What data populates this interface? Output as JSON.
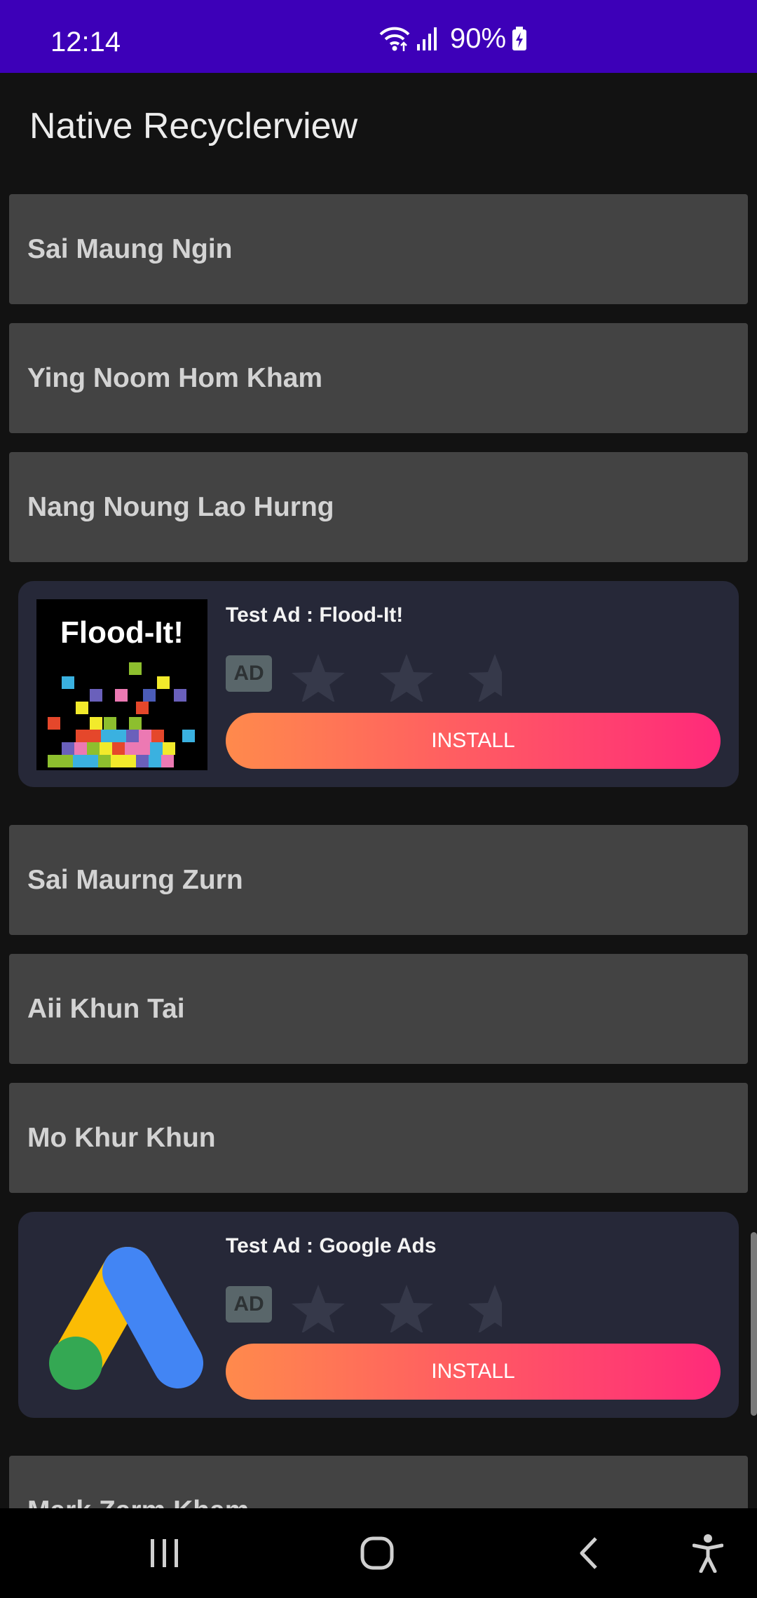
{
  "status_bar": {
    "time": "12:14",
    "battery_percent": "90%"
  },
  "app_bar": {
    "title": "Native Recyclerview"
  },
  "list_items": [
    {
      "label": "Sai Maung Ngin"
    },
    {
      "label": "Ying Noom Hom Kham"
    },
    {
      "label": "Nang Noung Lao Hurng"
    },
    {
      "label": "Sai Maurng Zurn"
    },
    {
      "label": "Aii Khun Tai"
    },
    {
      "label": "Mo Khur Khun"
    },
    {
      "label": "Mark Zarm Kham"
    }
  ],
  "ads": [
    {
      "title": "Test Ad : Flood-It!",
      "badge": "AD",
      "install_label": "INSTALL",
      "media_text": "Flood-It!",
      "stars": 0
    },
    {
      "title": "Test Ad : Google Ads",
      "badge": "AD",
      "install_label": "INSTALL",
      "stars": 0
    }
  ],
  "icons": [
    "wifi-icon",
    "signal-icon",
    "battery-charging-icon",
    "recent-apps-icon",
    "home-icon",
    "back-icon",
    "accessibility-icon"
  ]
}
